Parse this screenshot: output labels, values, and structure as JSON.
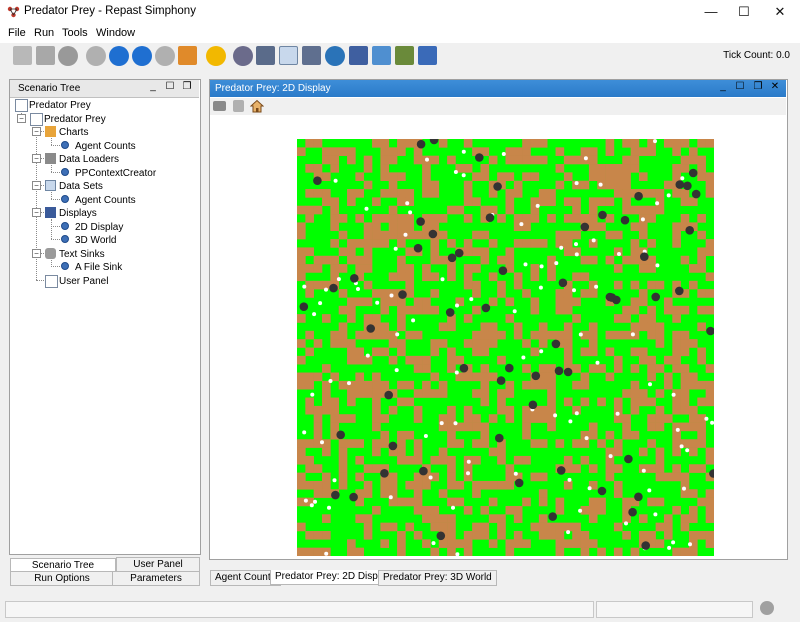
{
  "window": {
    "title": "Predator Prey - Repast Simphony",
    "minimize": "—",
    "maximize": "☐",
    "close": "✕"
  },
  "menu": {
    "items": [
      "File",
      "Run",
      "Tools",
      "Window"
    ]
  },
  "toolbar": {
    "tick_label": "Tick Count: 0.0"
  },
  "left_panel": {
    "title": "Scenario Tree",
    "tree": [
      {
        "label": "Predator Prey",
        "level": 0
      },
      {
        "label": "Predator Prey",
        "level": 1
      },
      {
        "label": "Charts",
        "level": 2
      },
      {
        "label": "Agent Counts",
        "level": 3
      },
      {
        "label": "Data Loaders",
        "level": 2
      },
      {
        "label": "PPContextCreator",
        "level": 3
      },
      {
        "label": "Data Sets",
        "level": 2
      },
      {
        "label": "Agent Counts",
        "level": 3
      },
      {
        "label": "Displays",
        "level": 2
      },
      {
        "label": "2D Display",
        "level": 3
      },
      {
        "label": "3D World",
        "level": 3
      },
      {
        "label": "Text Sinks",
        "level": 2
      },
      {
        "label": "A File Sink",
        "level": 3
      },
      {
        "label": "User Panel",
        "level": 2
      }
    ],
    "tabs": {
      "scenario_tree": "Scenario Tree",
      "user_panel": "User Panel",
      "run_options": "Run Options",
      "parameters": "Parameters"
    }
  },
  "right_panel": {
    "title": "Predator Prey: 2D Display",
    "tabs": [
      "Agent Counts",
      "Predator Prey: 2D Display",
      "Predator Prey: 3D World"
    ],
    "active_tab": 1
  },
  "colors": {
    "grass": "#00ff00",
    "dirt": "#c8864a",
    "wolf": "#333333",
    "sheep": "#ffffff",
    "header_blue": "#2f82d0"
  }
}
